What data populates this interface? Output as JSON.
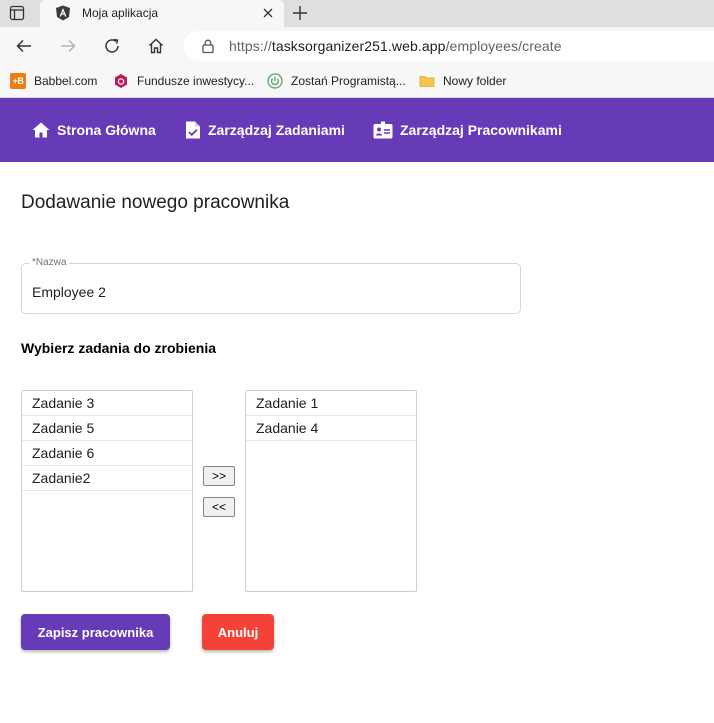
{
  "browser": {
    "tab_title": "Moja aplikacja",
    "url_prefix": "https://",
    "url_host": "tasksorganizer251.web.app",
    "url_path": "/employees/create",
    "bookmarks": [
      {
        "label": "Babbel.com",
        "icon": "babbel-icon",
        "badge": "+B"
      },
      {
        "label": "Fundusze inwestycy...",
        "icon": "fundusze-icon"
      },
      {
        "label": "Zostań Programistą...",
        "icon": "power-icon"
      },
      {
        "label": "Nowy folder",
        "icon": "folder-icon"
      }
    ]
  },
  "nav": {
    "home": "Strona Główna",
    "tasks": "Zarządzaj Zadaniami",
    "employees": "Zarządzaj Pracownikami"
  },
  "form": {
    "title": "Dodawanie nowego pracownika",
    "name_label": "*Nazwa",
    "name_value": "Employee 2",
    "tasks_title": "Wybierz zadania do zrobienia",
    "available_tasks": [
      "Zadanie 3",
      "Zadanie 5",
      "Zadanie 6",
      "Zadanie2"
    ],
    "selected_tasks": [
      "Zadanie 1",
      "Zadanie 4"
    ],
    "move_right_label": ">>",
    "move_left_label": "<<",
    "save_label": "Zapisz pracownika",
    "cancel_label": "Anuluj"
  },
  "colors": {
    "primary": "#673ab7",
    "warn": "#f44336"
  }
}
